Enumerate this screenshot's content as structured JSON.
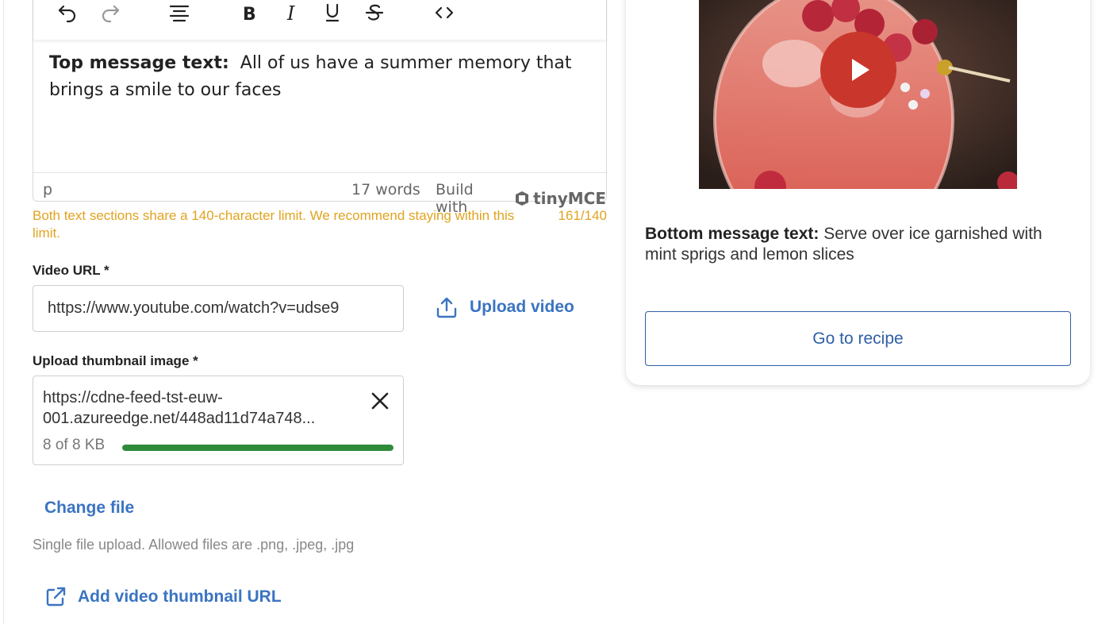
{
  "editor": {
    "toolbar": {
      "icons": [
        "undo-icon",
        "redo-icon",
        "align-center-icon",
        "bold-icon",
        "italic-icon",
        "underline-icon",
        "strikethrough-icon",
        "code-icon"
      ]
    },
    "top_label": "Top message text:",
    "top_text": "All of us have a summer memory that brings a smile to our faces",
    "status_element": "p",
    "word_count": "17 words",
    "build_with": "Build with",
    "brand": "tinyMCE"
  },
  "limit": {
    "message": "Both text sections share a 140-character limit. We recommend staying within this limit.",
    "counter": "161/140",
    "color": "#e0a31f"
  },
  "video_url": {
    "label": "Video URL *",
    "value": "https://www.youtube.com/watch?v=udse9"
  },
  "upload_video": {
    "label": "Upload video",
    "icon": "upload-icon"
  },
  "thumbnail": {
    "label": "Upload thumbnail image *",
    "file_url": "https://cdne-feed-tst-euw-001.azureedge.net/448ad11d74a748...",
    "size_text": "8 of 8 KB",
    "progress": 1.0,
    "progress_color": "#2e8b3a"
  },
  "change_file": "Change file",
  "hint": "Single file upload. Allowed files are .png, .jpeg, .jpg",
  "add_thumbnail_url": "Add video thumbnail URL",
  "preview": {
    "bottom_label": "Bottom message text:",
    "bottom_text": "Serve over ice garnished with mint sprigs and lemon slices",
    "button": "Go to recipe",
    "accent": "#2f5fa8",
    "play_color": "#c9372c"
  }
}
